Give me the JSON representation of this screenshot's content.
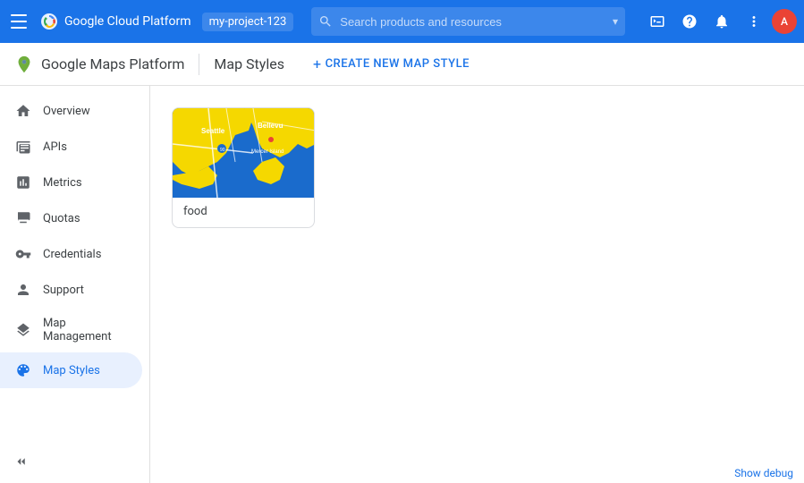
{
  "header": {
    "menu_label": "Main menu",
    "app_title": "Google Cloud Platform",
    "project_name": "my-project-123",
    "search_placeholder": "Search products and resources",
    "icons": {
      "console": "⊞",
      "help": "?",
      "notifications": "🔔",
      "more": "⋮"
    },
    "avatar_initials": "A"
  },
  "sub_header": {
    "product_name": "Google Maps Platform",
    "page_title": "Map Styles",
    "create_btn_label": "CREATE NEW MAP STYLE"
  },
  "sidebar": {
    "items": [
      {
        "id": "overview",
        "label": "Overview",
        "icon": "home"
      },
      {
        "id": "apis",
        "label": "APIs",
        "icon": "grid"
      },
      {
        "id": "metrics",
        "label": "Metrics",
        "icon": "bar_chart"
      },
      {
        "id": "quotas",
        "label": "Quotas",
        "icon": "monitor"
      },
      {
        "id": "credentials",
        "label": "Credentials",
        "icon": "key"
      },
      {
        "id": "support",
        "label": "Support",
        "icon": "person"
      },
      {
        "id": "map_management",
        "label": "Map Management",
        "icon": "layers"
      },
      {
        "id": "map_styles",
        "label": "Map Styles",
        "icon": "palette",
        "active": true
      }
    ],
    "collapse_label": "Collapse"
  },
  "main": {
    "map_style_card": {
      "label": "food"
    }
  },
  "footer": {
    "debug_label": "Show debug"
  }
}
